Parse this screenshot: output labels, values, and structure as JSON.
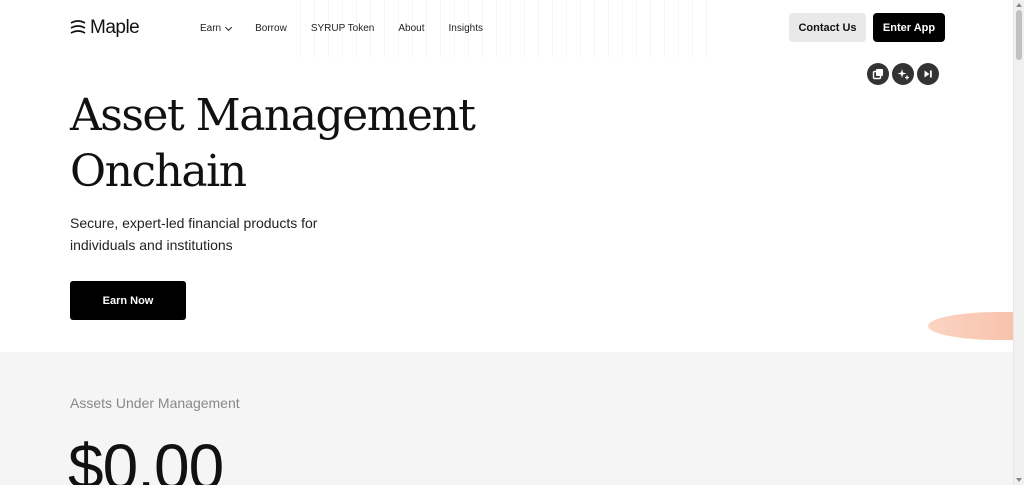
{
  "header": {
    "logo_text": "Maple",
    "nav": [
      {
        "label": "Earn",
        "has_dropdown": true
      },
      {
        "label": "Borrow"
      },
      {
        "label": "SYRUP Token"
      },
      {
        "label": "About"
      },
      {
        "label": "Insights"
      }
    ],
    "contact_label": "Contact Us",
    "enter_label": "Enter App"
  },
  "toolbar": {
    "icons": [
      "copy-icon",
      "sparkle-icon",
      "skip-icon"
    ]
  },
  "hero": {
    "title_line1": "Asset Management",
    "title_line2": "Onchain",
    "subtitle": "Secure, expert-led financial products for individuals and institutions",
    "cta_label": "Earn Now"
  },
  "aum": {
    "label": "Assets Under Management",
    "value": "$0.00"
  },
  "colors": {
    "primary": "#000000",
    "accent_blob": "#f6b79f",
    "section_bg": "#f5f5f5"
  }
}
